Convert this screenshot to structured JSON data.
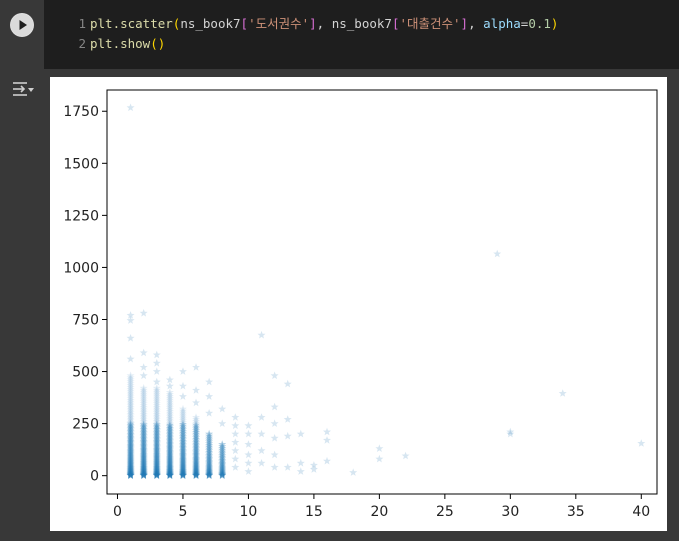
{
  "code": {
    "line1": {
      "number": "1",
      "func": "plt.scatter",
      "arg1_var": "ns_book7",
      "arg1_key": "'도서권수'",
      "arg2_var": "ns_book7",
      "arg2_key": "'대출건수'",
      "param_name": "alpha",
      "param_value": "0.1"
    },
    "line2": {
      "number": "2",
      "func": "plt.show"
    }
  },
  "icons": {
    "run": "play-circle-icon",
    "output_toggle": "output-collapse-icon"
  },
  "colors": {
    "marker": "#1f77b4",
    "code_bg": "#1e1e1e",
    "panel_bg": "#383838"
  },
  "chart_data": {
    "type": "scatter",
    "marker": "star",
    "alpha": 0.1,
    "xlim": [
      -0.8,
      41.2
    ],
    "ylim": [
      -88,
      1852
    ],
    "xticks": [
      0,
      5,
      10,
      15,
      20,
      25,
      30,
      35,
      40
    ],
    "yticks": [
      0,
      250,
      500,
      750,
      1000,
      1250,
      1500,
      1750
    ],
    "dense_columns": [
      {
        "x": 1,
        "ymax": 480
      },
      {
        "x": 2,
        "ymax": 420
      },
      {
        "x": 3,
        "ymax": 420
      },
      {
        "x": 4,
        "ymax": 400
      },
      {
        "x": 5,
        "ymax": 320
      },
      {
        "x": 6,
        "ymax": 280
      },
      {
        "x": 7,
        "ymax": 200
      },
      {
        "x": 8,
        "ymax": 150
      }
    ],
    "points": [
      {
        "x": 1,
        "y": 1767
      },
      {
        "x": 1,
        "y": 770
      },
      {
        "x": 1,
        "y": 745
      },
      {
        "x": 1,
        "y": 660
      },
      {
        "x": 1,
        "y": 560
      },
      {
        "x": 2,
        "y": 780
      },
      {
        "x": 2,
        "y": 590
      },
      {
        "x": 2,
        "y": 520
      },
      {
        "x": 2,
        "y": 480
      },
      {
        "x": 3,
        "y": 580
      },
      {
        "x": 3,
        "y": 540
      },
      {
        "x": 3,
        "y": 500
      },
      {
        "x": 3,
        "y": 450
      },
      {
        "x": 4,
        "y": 460
      },
      {
        "x": 4,
        "y": 430
      },
      {
        "x": 5,
        "y": 500
      },
      {
        "x": 5,
        "y": 430
      },
      {
        "x": 5,
        "y": 380
      },
      {
        "x": 6,
        "y": 520
      },
      {
        "x": 6,
        "y": 410
      },
      {
        "x": 6,
        "y": 350
      },
      {
        "x": 7,
        "y": 450
      },
      {
        "x": 7,
        "y": 380
      },
      {
        "x": 7,
        "y": 300
      },
      {
        "x": 8,
        "y": 320
      },
      {
        "x": 8,
        "y": 250
      },
      {
        "x": 9,
        "y": 280
      },
      {
        "x": 9,
        "y": 240
      },
      {
        "x": 9,
        "y": 200
      },
      {
        "x": 9,
        "y": 160
      },
      {
        "x": 9,
        "y": 120
      },
      {
        "x": 9,
        "y": 80
      },
      {
        "x": 9,
        "y": 40
      },
      {
        "x": 10,
        "y": 240
      },
      {
        "x": 10,
        "y": 200
      },
      {
        "x": 10,
        "y": 150
      },
      {
        "x": 10,
        "y": 100
      },
      {
        "x": 10,
        "y": 60
      },
      {
        "x": 10,
        "y": 20
      },
      {
        "x": 11,
        "y": 675
      },
      {
        "x": 11,
        "y": 280
      },
      {
        "x": 11,
        "y": 200
      },
      {
        "x": 11,
        "y": 120
      },
      {
        "x": 11,
        "y": 60
      },
      {
        "x": 12,
        "y": 480
      },
      {
        "x": 12,
        "y": 330
      },
      {
        "x": 12,
        "y": 250
      },
      {
        "x": 12,
        "y": 180
      },
      {
        "x": 12,
        "y": 100
      },
      {
        "x": 12,
        "y": 40
      },
      {
        "x": 13,
        "y": 440
      },
      {
        "x": 13,
        "y": 270
      },
      {
        "x": 13,
        "y": 190
      },
      {
        "x": 13,
        "y": 40
      },
      {
        "x": 14,
        "y": 200
      },
      {
        "x": 14,
        "y": 60
      },
      {
        "x": 14,
        "y": 20
      },
      {
        "x": 15,
        "y": 50
      },
      {
        "x": 15,
        "y": 30
      },
      {
        "x": 16,
        "y": 210
      },
      {
        "x": 16,
        "y": 170
      },
      {
        "x": 16,
        "y": 70
      },
      {
        "x": 18,
        "y": 15
      },
      {
        "x": 20,
        "y": 130
      },
      {
        "x": 20,
        "y": 80
      },
      {
        "x": 22,
        "y": 95
      },
      {
        "x": 29,
        "y": 1065
      },
      {
        "x": 30,
        "y": 210
      },
      {
        "x": 30,
        "y": 200
      },
      {
        "x": 34,
        "y": 395
      },
      {
        "x": 40,
        "y": 155
      }
    ]
  }
}
